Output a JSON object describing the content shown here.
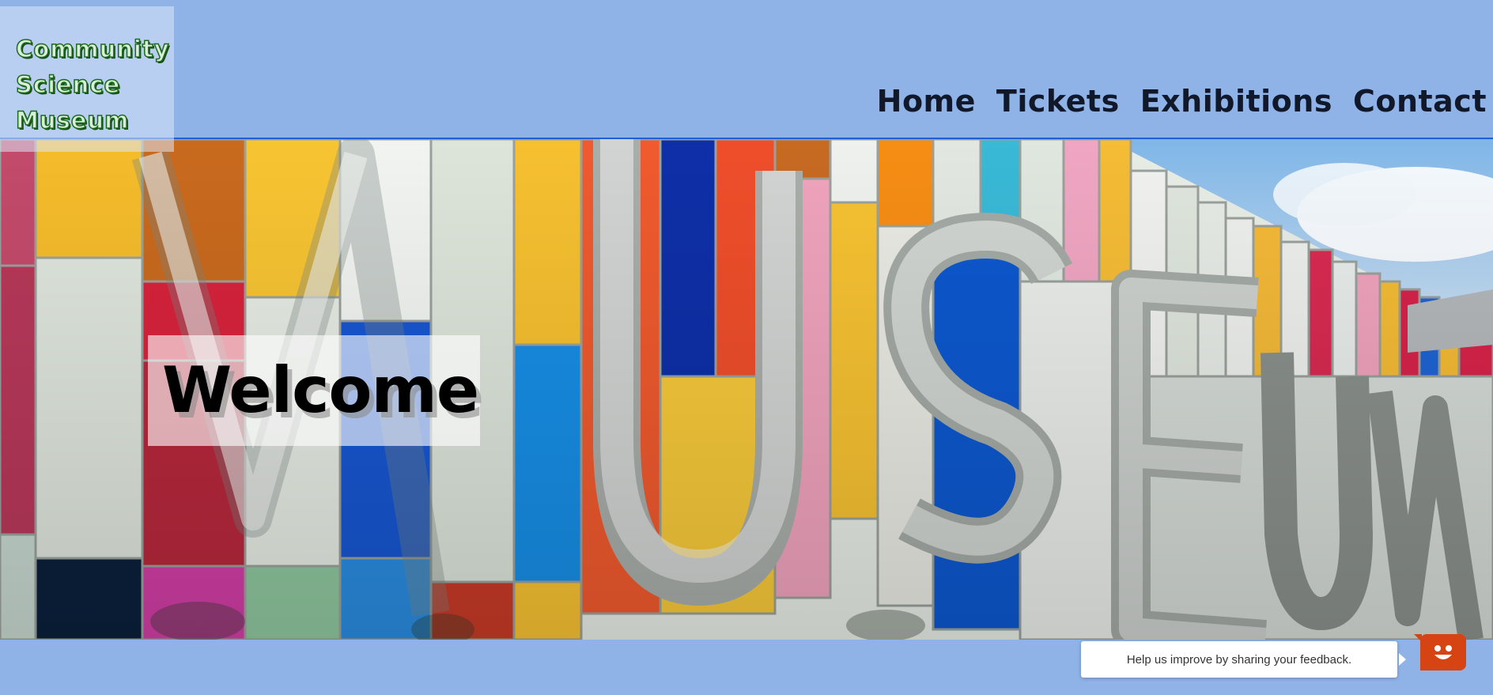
{
  "logo": {
    "lines": [
      "Community",
      "Science",
      "Museum"
    ]
  },
  "nav": {
    "items": [
      "Home",
      "Tickets",
      "Exhibitions",
      "Contact"
    ]
  },
  "hero": {
    "welcome": "Welcome"
  },
  "feedback": {
    "prompt": "Help us improve by sharing your feedback.",
    "icon": "smiley-face-icon"
  },
  "colors": {
    "background": "#8fb2e7",
    "header_border": "#1f5fd6",
    "logo_text": "#1c6b1c",
    "nav_text": "#10182a",
    "feedback_button": "#d64413"
  }
}
